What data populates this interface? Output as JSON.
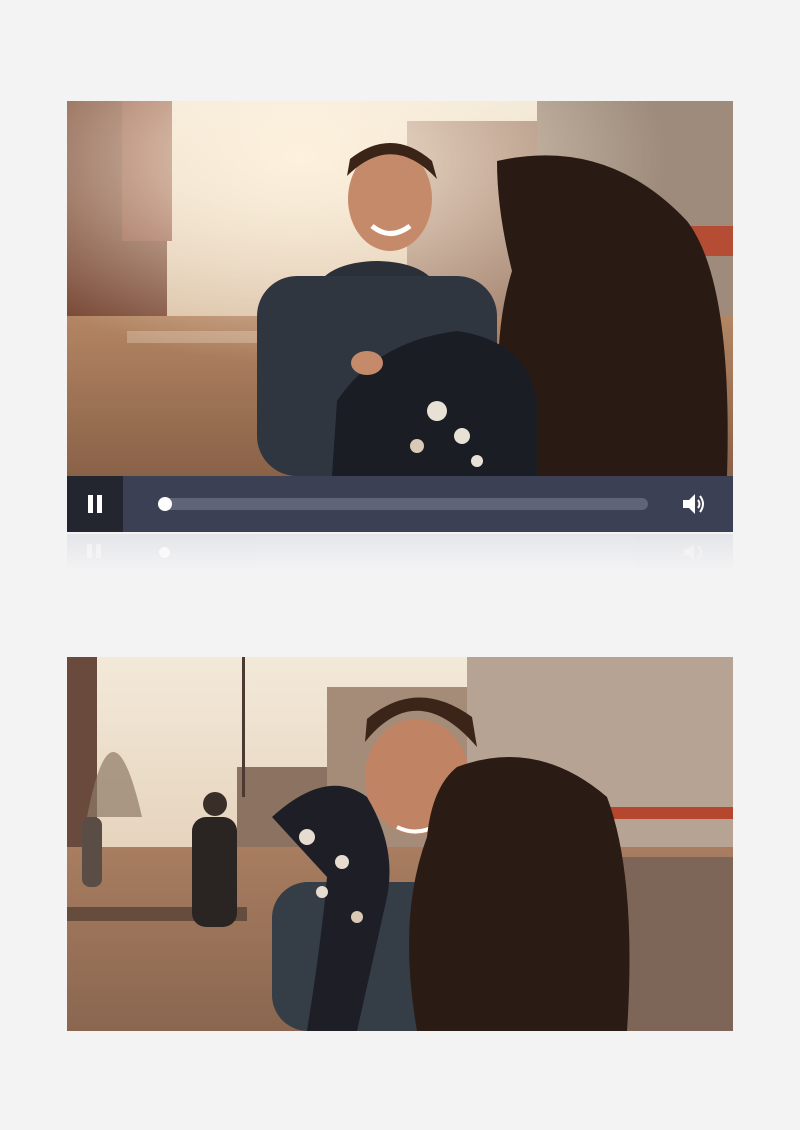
{
  "player": {
    "state": "paused-control-visible",
    "progress": 0.0,
    "controls": {
      "pause_icon": "pause-icon",
      "volume_icon": "volume-icon"
    }
  },
  "colors": {
    "page_background": "#f3f3f4",
    "control_bar": "#3c4054",
    "pause_button": "#23252f",
    "progress_track": "#5f6479",
    "progress_thumb": "#ffffff"
  }
}
